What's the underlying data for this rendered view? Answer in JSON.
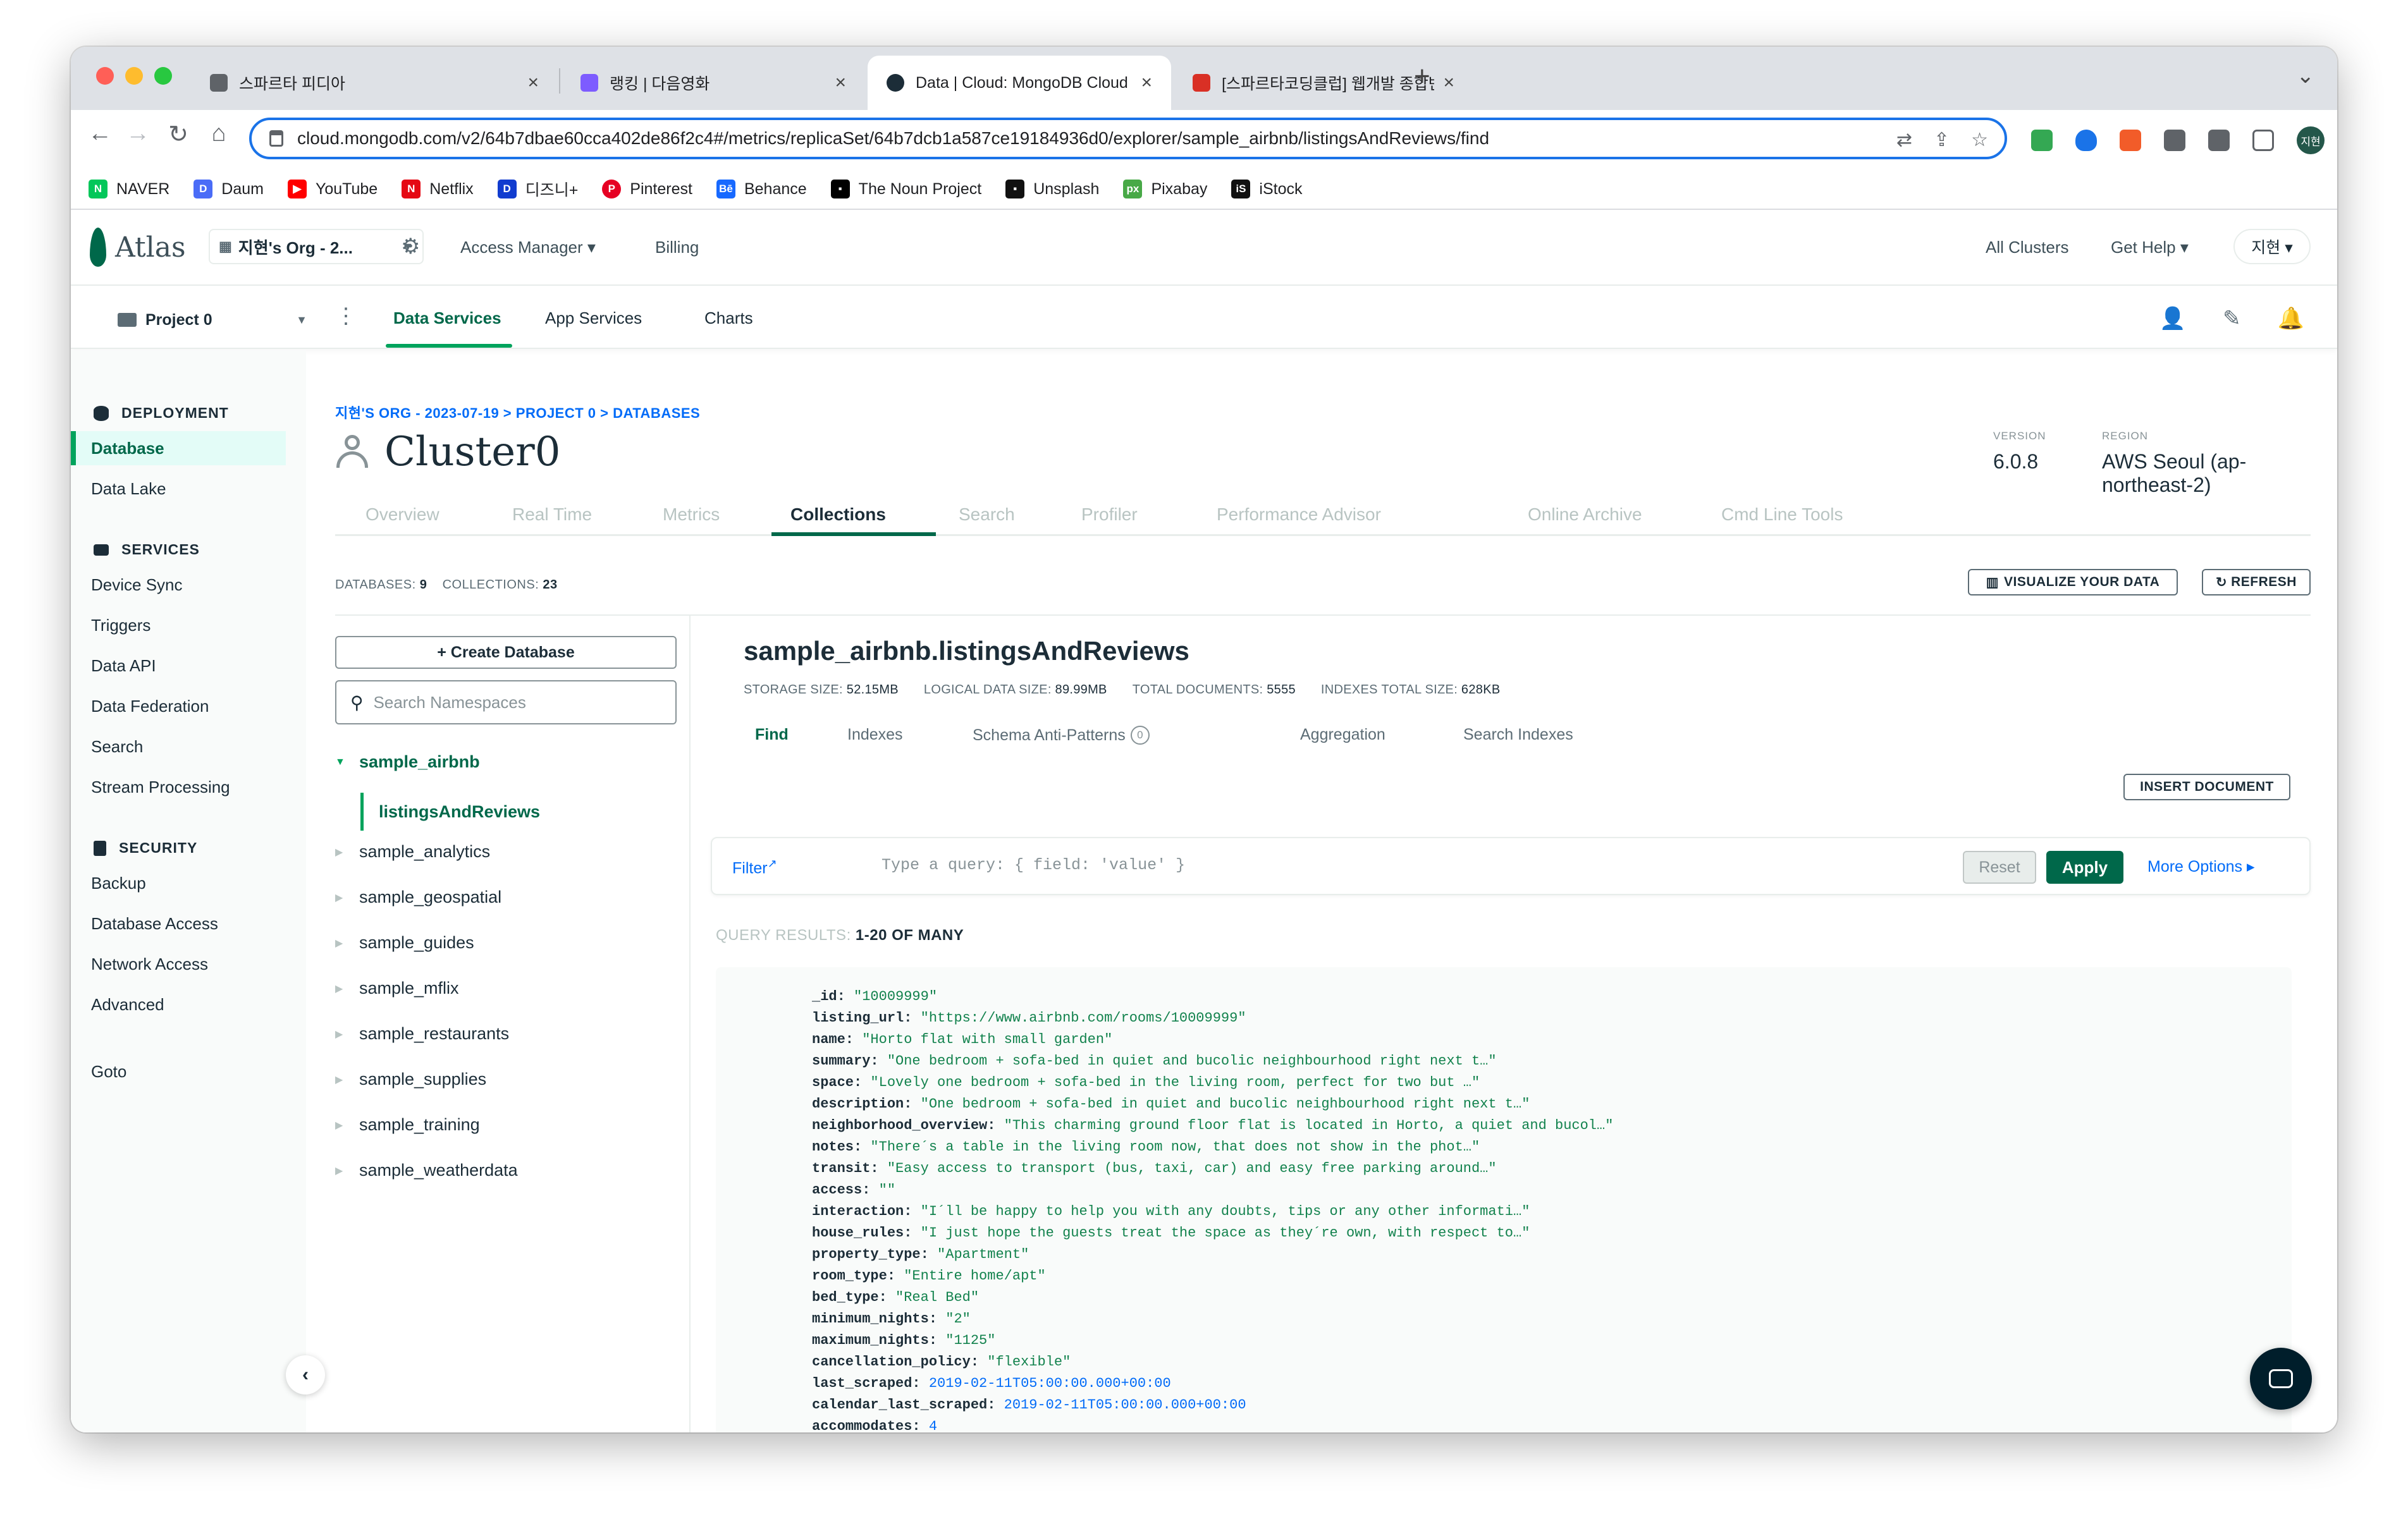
{
  "browser": {
    "tabs": [
      {
        "title": "스파르타 피디아",
        "icon_color": "#5f6368"
      },
      {
        "title": "랭킹 | 다음영화",
        "icon_color": "#7d5cff"
      },
      {
        "title": "Data | Cloud: MongoDB Cloud",
        "icon_color": "#00684a"
      },
      {
        "title": "[스파르타코딩클럽] 웹개발 종합반 -",
        "icon_color": "#d93025"
      }
    ],
    "close_glyph": "×",
    "new_tab": "+",
    "tab_menu": "⌄",
    "url": "cloud.mongodb.com/v2/64b7dbae60cca402de86f2c4#/metrics/replicaSet/64b7dcb1a587ce19184936d0/explorer/sample_airbnb/listingsAndReviews/find",
    "nav": {
      "back": "←",
      "forward": "→",
      "reload": "↻",
      "home": "⌂"
    },
    "omnibox_icons": [
      "⇄",
      "⇪",
      "☆"
    ],
    "profile_initials": "지현",
    "bookmarks": [
      {
        "label": "NAVER",
        "icon": "N",
        "color": "#03c75a"
      },
      {
        "label": "Daum",
        "icon": "D",
        "color": "#4a6cf7"
      },
      {
        "label": "YouTube",
        "icon": "▶",
        "color": "#ff0000"
      },
      {
        "label": "Netflix",
        "icon": "N",
        "color": "#e50914"
      },
      {
        "label": "디즈니+",
        "icon": "D",
        "color": "#113ccf"
      },
      {
        "label": "Pinterest",
        "icon": "P",
        "color": "#e60023"
      },
      {
        "label": "Behance",
        "icon": "Bē",
        "color": "#1769ff"
      },
      {
        "label": "The Noun Project",
        "icon": "▪",
        "color": "#000000"
      },
      {
        "label": "Unsplash",
        "icon": "▪",
        "color": "#111111"
      },
      {
        "label": "Pixabay",
        "icon": "px",
        "color": "#48a947"
      },
      {
        "label": "iStock",
        "icon": "iS",
        "color": "#111111"
      }
    ]
  },
  "topnav": {
    "logo_text": "Atlas",
    "org_label": "지현's Org - 2...",
    "links": [
      "Access Manager ▾",
      "Billing"
    ],
    "right_links": [
      "All Clusters",
      "Get Help ▾"
    ],
    "user": "지현 ▾"
  },
  "subnav": {
    "project": "Project 0",
    "tabs": [
      "Data Services",
      "App Services",
      "Charts"
    ],
    "active_tab": "Data Services"
  },
  "sidebar": {
    "sections": [
      {
        "title": "DEPLOYMENT",
        "items": [
          "Database",
          "Data Lake"
        ]
      },
      {
        "title": "SERVICES",
        "items": [
          "Device Sync",
          "Triggers",
          "Data API",
          "Data Federation",
          "Search",
          "Stream Processing"
        ]
      },
      {
        "title": "SECURITY",
        "items": [
          "Backup",
          "Database Access",
          "Network Access",
          "Advanced"
        ]
      }
    ],
    "active_item": "Database",
    "extra": "Goto"
  },
  "cluster": {
    "breadcrumb": "지현'S ORG - 2023-07-19 > PROJECT 0 > DATABASES",
    "name": "Cluster0",
    "version_label": "VERSION",
    "version": "6.0.8",
    "region_label": "REGION",
    "region": "AWS Seoul (ap-northeast-2)",
    "tabs": [
      "Overview",
      "Real Time",
      "Metrics",
      "Collections",
      "Search",
      "Profiler",
      "Performance Advisor",
      "Online Archive",
      "Cmd Line Tools"
    ],
    "active_tab": "Collections"
  },
  "collections": {
    "databases_label": "DATABASES:",
    "databases_count": "9",
    "collections_label": "COLLECTIONS:",
    "collections_count": "23",
    "visualize_btn": "VISUALIZE YOUR DATA",
    "refresh_btn": "REFRESH",
    "create_db": "+ Create Database",
    "search_placeholder": "Search Namespaces",
    "databases": [
      "sample_airbnb",
      "sample_analytics",
      "sample_geospatial",
      "sample_guides",
      "sample_mflix",
      "sample_restaurants",
      "sample_supplies",
      "sample_training",
      "sample_weatherdata"
    ],
    "open_collection": "listingsAndReviews"
  },
  "detail": {
    "namespace": "sample_airbnb.listingsAndReviews",
    "stats": [
      {
        "label": "STORAGE SIZE:",
        "value": "52.15MB"
      },
      {
        "label": "LOGICAL DATA SIZE:",
        "value": "89.99MB"
      },
      {
        "label": "TOTAL DOCUMENTS:",
        "value": "5555"
      },
      {
        "label": "INDEXES TOTAL SIZE:",
        "value": "628KB"
      }
    ],
    "tabs": [
      "Find",
      "Indexes",
      "Schema Anti-Patterns",
      "Aggregation",
      "Search Indexes"
    ],
    "active_tab": "Find",
    "anti_patterns_badge": "0",
    "insert_btn": "INSERT DOCUMENT",
    "filter_label": "Filter",
    "filter_placeholder": "Type a query: { field: 'value' }",
    "reset_btn": "Reset",
    "apply_btn": "Apply",
    "more_options": "More Options ▸",
    "results_label": "QUERY RESULTS:",
    "results_value": "1-20 OF MANY"
  },
  "document": [
    {
      "key": "_id:",
      "value": "\"10009999\"",
      "kind": "string"
    },
    {
      "key": "listing_url:",
      "value": "\"https://www.airbnb.com/rooms/10009999\"",
      "kind": "string"
    },
    {
      "key": "name:",
      "value": "\"Horto flat with small garden\"",
      "kind": "string"
    },
    {
      "key": "summary:",
      "value": "\"One bedroom + sofa-bed in quiet and bucolic neighbourhood right next t…\"",
      "kind": "string"
    },
    {
      "key": "space:",
      "value": "\"Lovely one bedroom + sofa-bed in the living room, perfect for two but …\"",
      "kind": "string"
    },
    {
      "key": "description:",
      "value": "\"One bedroom + sofa-bed in quiet and bucolic neighbourhood right next t…\"",
      "kind": "string"
    },
    {
      "key": "neighborhood_overview:",
      "value": "\"This charming ground floor flat is located in Horto, a quiet and bucol…\"",
      "kind": "string"
    },
    {
      "key": "notes:",
      "value": "\"There´s a table in the living room now, that does not show in the phot…\"",
      "kind": "string"
    },
    {
      "key": "transit:",
      "value": "\"Easy access to transport (bus, taxi, car) and easy free parking around…\"",
      "kind": "string"
    },
    {
      "key": "access:",
      "value": "\"\"",
      "kind": "string"
    },
    {
      "key": "interaction:",
      "value": "\"I´ll be happy to help you with any doubts, tips or any other informati…\"",
      "kind": "string"
    },
    {
      "key": "house_rules:",
      "value": "\"I just hope the guests treat the space as they´re own, with respect to…\"",
      "kind": "string"
    },
    {
      "key": "property_type:",
      "value": "\"Apartment\"",
      "kind": "string"
    },
    {
      "key": "room_type:",
      "value": "\"Entire home/apt\"",
      "kind": "string"
    },
    {
      "key": "bed_type:",
      "value": "\"Real Bed\"",
      "kind": "string"
    },
    {
      "key": "minimum_nights:",
      "value": "\"2\"",
      "kind": "string"
    },
    {
      "key": "maximum_nights:",
      "value": "\"1125\"",
      "kind": "string"
    },
    {
      "key": "cancellation_policy:",
      "value": "\"flexible\"",
      "kind": "string"
    },
    {
      "key": "last_scraped:",
      "value": "2019-02-11T05:00:00.000+00:00",
      "kind": "date"
    },
    {
      "key": "calendar_last_scraped:",
      "value": "2019-02-11T05:00:00.000+00:00",
      "kind": "date"
    },
    {
      "key": "accommodates:",
      "value": "4",
      "kind": "number"
    }
  ],
  "colors": {
    "brand_green": "#00684a",
    "accent_green": "#00a35c",
    "link_blue": "#016bf8"
  }
}
